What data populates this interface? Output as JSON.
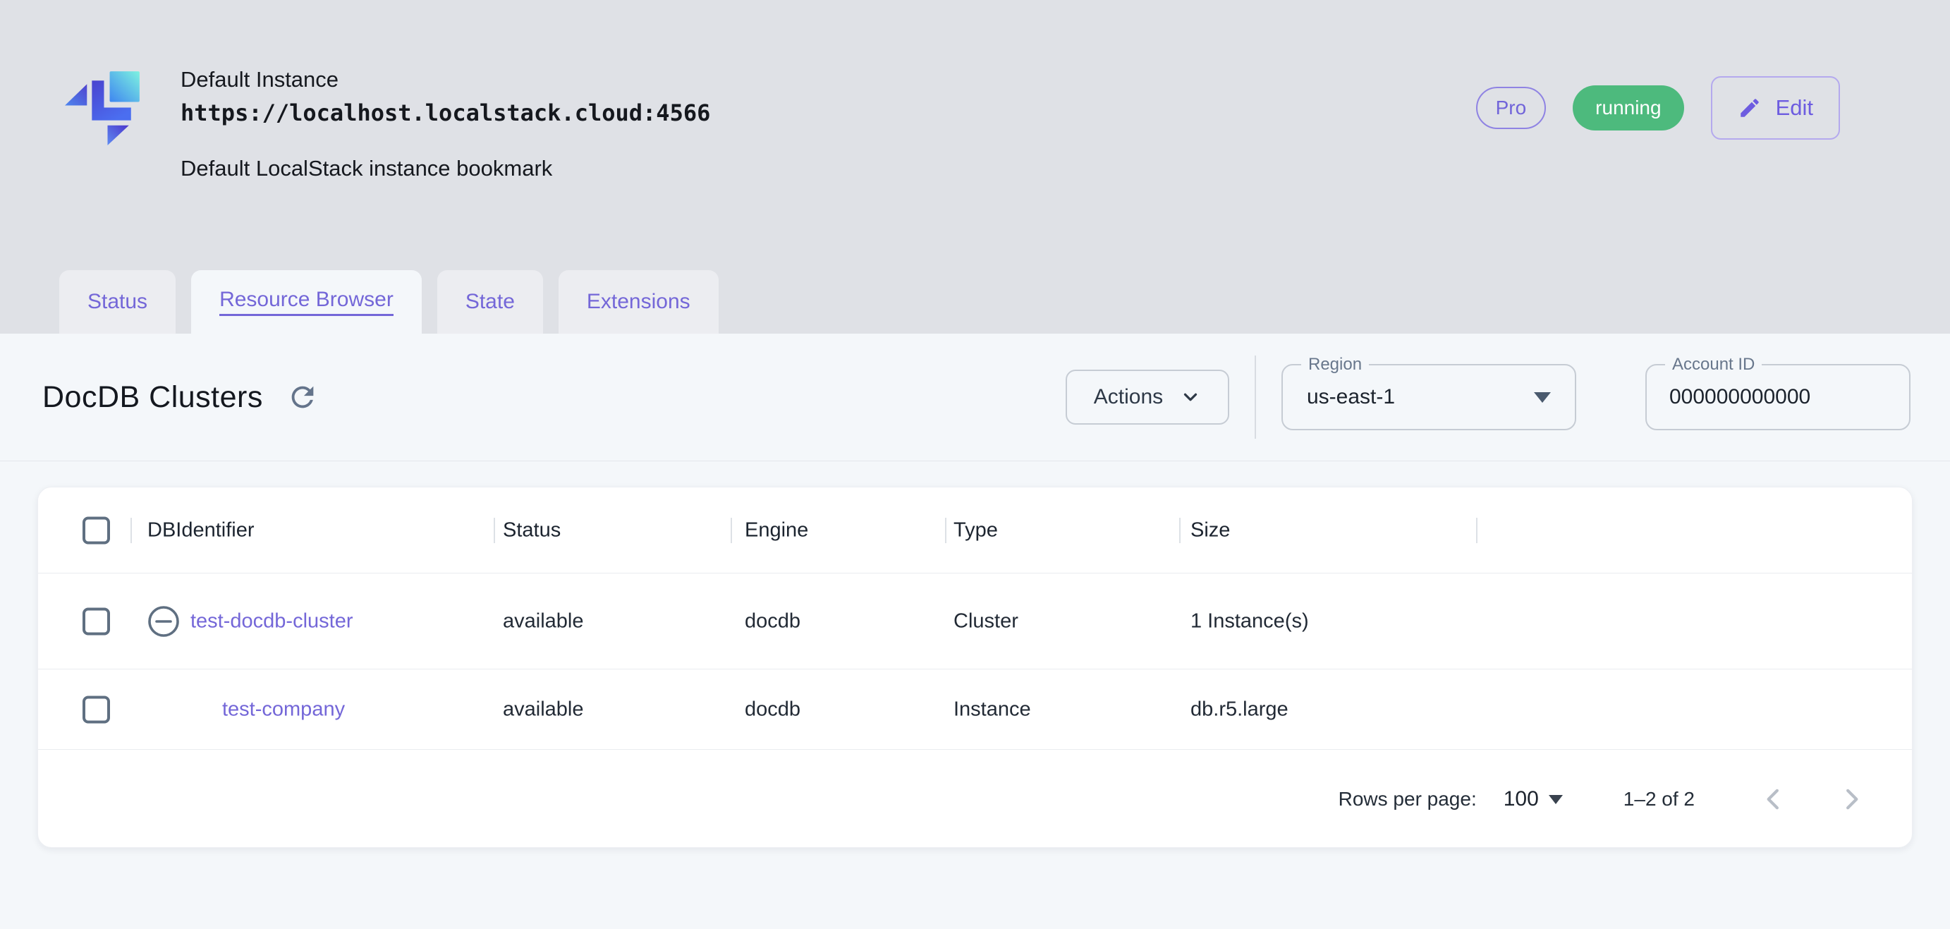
{
  "header": {
    "title": "Default Instance",
    "url": "https://localhost.localstack.cloud:4566",
    "subtitle": "Default LocalStack instance bookmark",
    "pro_badge": "Pro",
    "status_badge": "running",
    "edit_label": "Edit"
  },
  "tabs": [
    {
      "label": "Status"
    },
    {
      "label": "Resource Browser"
    },
    {
      "label": "State"
    },
    {
      "label": "Extensions"
    }
  ],
  "toolbar": {
    "page_title": "DocDB Clusters",
    "actions_label": "Actions",
    "region": {
      "label": "Region",
      "value": "us-east-1"
    },
    "account": {
      "label": "Account ID",
      "value": "000000000000"
    }
  },
  "table": {
    "columns": [
      "DBIdentifier",
      "Status",
      "Engine",
      "Type",
      "Size"
    ],
    "rows": [
      {
        "id": "test-docdb-cluster",
        "status": "available",
        "engine": "docdb",
        "type": "Cluster",
        "size": "1 Instance(s)"
      },
      {
        "id": "test-company",
        "status": "available",
        "engine": "docdb",
        "type": "Instance",
        "size": "db.r5.large"
      }
    ]
  },
  "pagination": {
    "rows_per_page_label": "Rows per page:",
    "rows_per_page_value": "100",
    "range": "1–2 of 2"
  },
  "colors": {
    "accent_purple": "#7467d8",
    "running_green": "#4dba7d",
    "slate_icon": "#5f6f81",
    "header_gray": "#dfe1e6"
  }
}
